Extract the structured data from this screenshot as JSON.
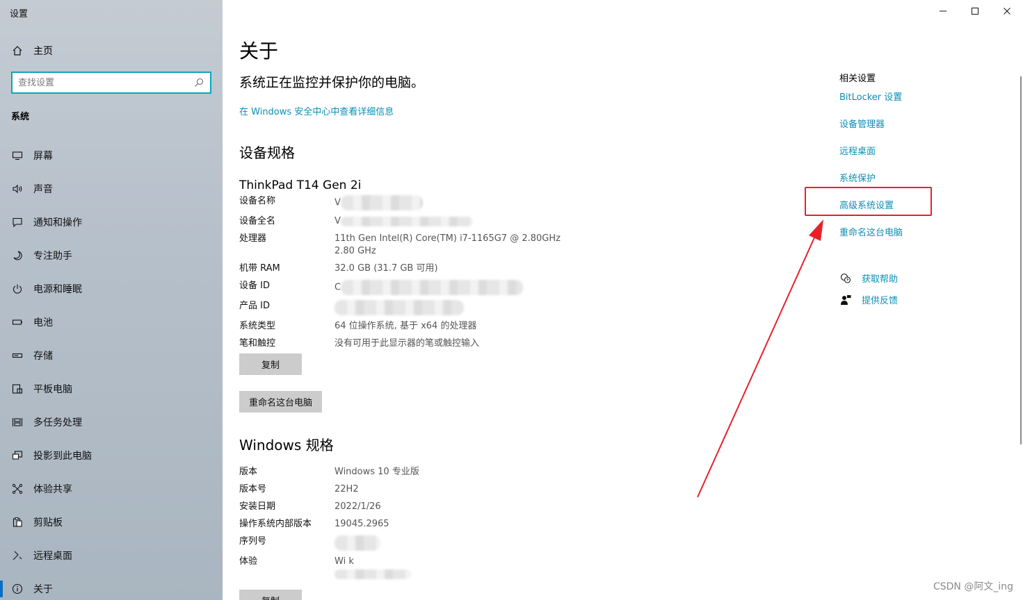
{
  "window": {
    "title": "设置"
  },
  "sidebar": {
    "home_label": "主页",
    "search_placeholder": "查找设置",
    "section_title": "系统",
    "items": [
      {
        "label": "屏幕",
        "icon": "monitor-icon"
      },
      {
        "label": "声音",
        "icon": "speaker-icon"
      },
      {
        "label": "通知和操作",
        "icon": "notification-icon"
      },
      {
        "label": "专注助手",
        "icon": "moon-icon"
      },
      {
        "label": "电源和睡眠",
        "icon": "power-icon"
      },
      {
        "label": "电池",
        "icon": "battery-icon"
      },
      {
        "label": "存储",
        "icon": "storage-icon"
      },
      {
        "label": "平板电脑",
        "icon": "tablet-icon"
      },
      {
        "label": "多任务处理",
        "icon": "multitask-icon"
      },
      {
        "label": "投影到此电脑",
        "icon": "project-icon"
      },
      {
        "label": "体验共享",
        "icon": "share-icon"
      },
      {
        "label": "剪贴板",
        "icon": "clipboard-icon"
      },
      {
        "label": "远程桌面",
        "icon": "remote-desktop-icon"
      },
      {
        "label": "关于",
        "icon": "info-icon",
        "active": true
      }
    ]
  },
  "main": {
    "title": "关于",
    "status": "系统正在监控并保护你的电脑。",
    "security_link": "在 Windows 安全中心中查看详细信息",
    "device_spec_title": "设备规格",
    "device_model": "ThinkPad T14 Gen 2i",
    "device_specs": [
      {
        "key": "设备名称",
        "value": "V",
        "blurred": true
      },
      {
        "key": "设备全名",
        "value": "V",
        "blurred": true
      },
      {
        "key": "处理器",
        "value": "11th Gen Intel(R) Core(TM) i7-1165G7 @ 2.80GHz\n2.80 GHz"
      },
      {
        "key": "机带 RAM",
        "value": "32.0 GB (31.7 GB 可用)"
      },
      {
        "key": "设备 ID",
        "value": "C",
        "blurred": true
      },
      {
        "key": "产品 ID",
        "value": "",
        "blurred": true
      },
      {
        "key": "系统类型",
        "value": "64 位操作系统, 基于 x64 的处理器"
      },
      {
        "key": "笔和触控",
        "value": "没有可用于此显示器的笔或触控输入"
      }
    ],
    "copy_button": "复制",
    "rename_button": "重命名这台电脑",
    "windows_spec_title": "Windows 规格",
    "windows_specs": [
      {
        "key": "版本",
        "value": "Windows 10 专业版"
      },
      {
        "key": "版本号",
        "value": "22H2"
      },
      {
        "key": "安装日期",
        "value": "2022/1/26"
      },
      {
        "key": "操作系统内部版本",
        "value": "19045.2965"
      },
      {
        "key": "序列号",
        "value": "",
        "blurred": true
      },
      {
        "key": "体验",
        "value": "Wi           k",
        "blurred": true
      }
    ],
    "copy_button_2": "复制"
  },
  "related": {
    "title": "相关设置",
    "links": [
      "BitLocker 设置",
      "设备管理器",
      "远程桌面",
      "系统保护",
      "高级系统设置",
      "重命名这台电脑"
    ],
    "help_label": "获取帮助",
    "feedback_label": "提供反馈"
  },
  "annotation": {
    "highlight_color": "#e8202a"
  },
  "watermark": "CSDN @阿文_ing",
  "colors": {
    "accent": "#0a8fb5",
    "search_border": "#0aa6b8"
  }
}
